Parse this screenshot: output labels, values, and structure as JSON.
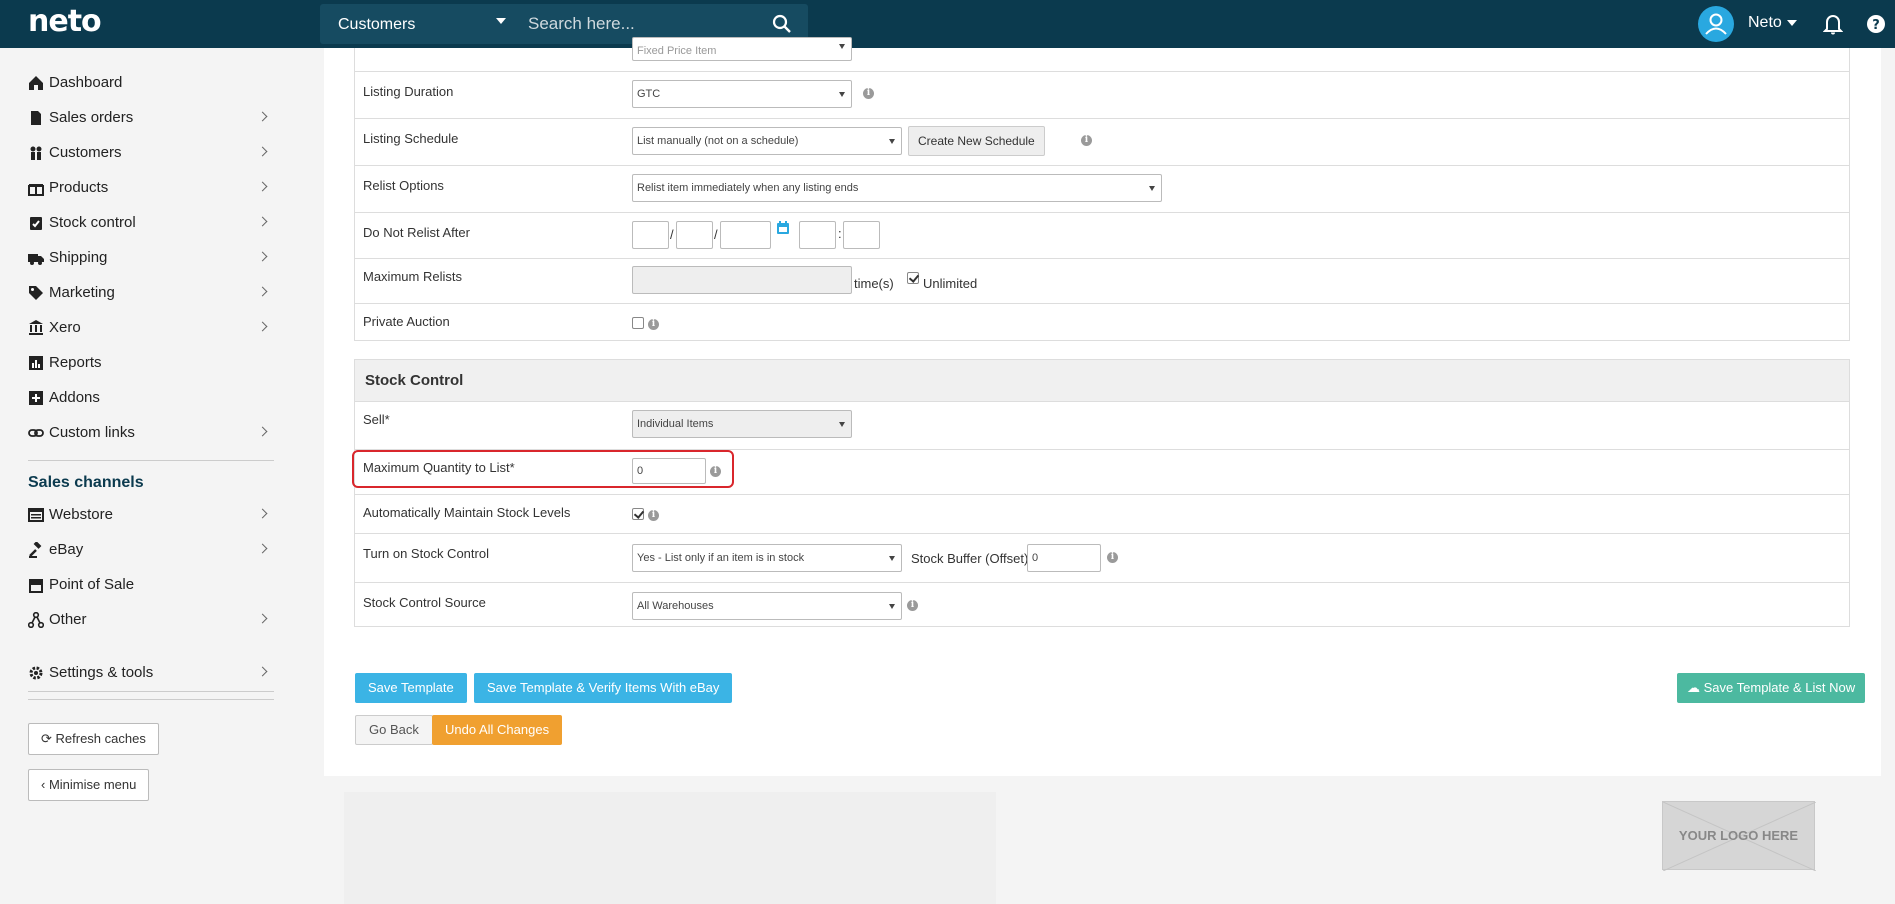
{
  "header": {
    "logo": "neto",
    "search_scope": "Customers",
    "search_placeholder": "Search here...",
    "user_name": "Neto"
  },
  "sidebar": {
    "items": [
      {
        "label": "Dashboard",
        "icon": "home-icon",
        "chevron": false
      },
      {
        "label": "Sales orders",
        "icon": "document-icon",
        "chevron": true
      },
      {
        "label": "Customers",
        "icon": "users-icon",
        "chevron": true
      },
      {
        "label": "Products",
        "icon": "gift-icon",
        "chevron": true
      },
      {
        "label": "Stock control",
        "icon": "clipboard-check-icon",
        "chevron": true
      },
      {
        "label": "Shipping",
        "icon": "truck-icon",
        "chevron": true
      },
      {
        "label": "Marketing",
        "icon": "tag-icon",
        "chevron": true
      },
      {
        "label": "Xero",
        "icon": "bank-icon",
        "chevron": true
      },
      {
        "label": "Reports",
        "icon": "chart-icon",
        "chevron": false
      },
      {
        "label": "Addons",
        "icon": "plus-square-icon",
        "chevron": false
      },
      {
        "label": "Custom links",
        "icon": "link-icon",
        "chevron": true
      }
    ],
    "channels_heading": "Sales channels",
    "channels": [
      {
        "label": "Webstore",
        "icon": "browser-icon",
        "chevron": true
      },
      {
        "label": "eBay",
        "icon": "gavel-icon",
        "chevron": true
      },
      {
        "label": "Point of Sale",
        "icon": "store-icon",
        "chevron": false
      },
      {
        "label": "Other",
        "icon": "share-icon",
        "chevron": true
      }
    ],
    "settings": {
      "label": "Settings & tools",
      "icon": "gear-icon"
    },
    "refresh_label": "Refresh caches",
    "minimise_label": "Minimise menu"
  },
  "listing": {
    "top_select_value": "Fixed Price Item",
    "duration_label": "Listing Duration",
    "duration_value": "GTC",
    "schedule_label": "Listing Schedule",
    "schedule_value": "List manually (not on a schedule)",
    "schedule_button": "Create New Schedule",
    "relist_label": "Relist Options",
    "relist_value": "Relist item immediately when any listing ends",
    "donot_label": "Do Not Relist After",
    "date_sep": "/",
    "time_sep": ":",
    "max_relists_label": "Maximum Relists",
    "times_label": "time(s)",
    "unlimited_label": "Unlimited",
    "private_label": "Private Auction"
  },
  "stock": {
    "heading": "Stock Control",
    "sell_label": "Sell*",
    "sell_value": "Individual Items",
    "maxqty_label": "Maximum Quantity to List*",
    "maxqty_value": "0",
    "auto_label": "Automatically Maintain Stock Levels",
    "turnon_label": "Turn on Stock Control",
    "turnon_value": "Yes - List only if an item is in stock",
    "buffer_label": "Stock Buffer (Offset)",
    "buffer_value": "0",
    "source_label": "Stock Control Source",
    "source_value": "All Warehouses"
  },
  "actions": {
    "save": "Save Template",
    "save_verify": "Save Template & Verify Items With eBay",
    "save_list": "Save Template & List Now",
    "go_back": "Go Back",
    "undo": "Undo All Changes"
  },
  "footer": {
    "logo_placeholder": "YOUR LOGO HERE"
  },
  "colors": {
    "topbar": "#0b3a4e",
    "accent": "#3bb4e5",
    "highlight": "#d9262c"
  }
}
